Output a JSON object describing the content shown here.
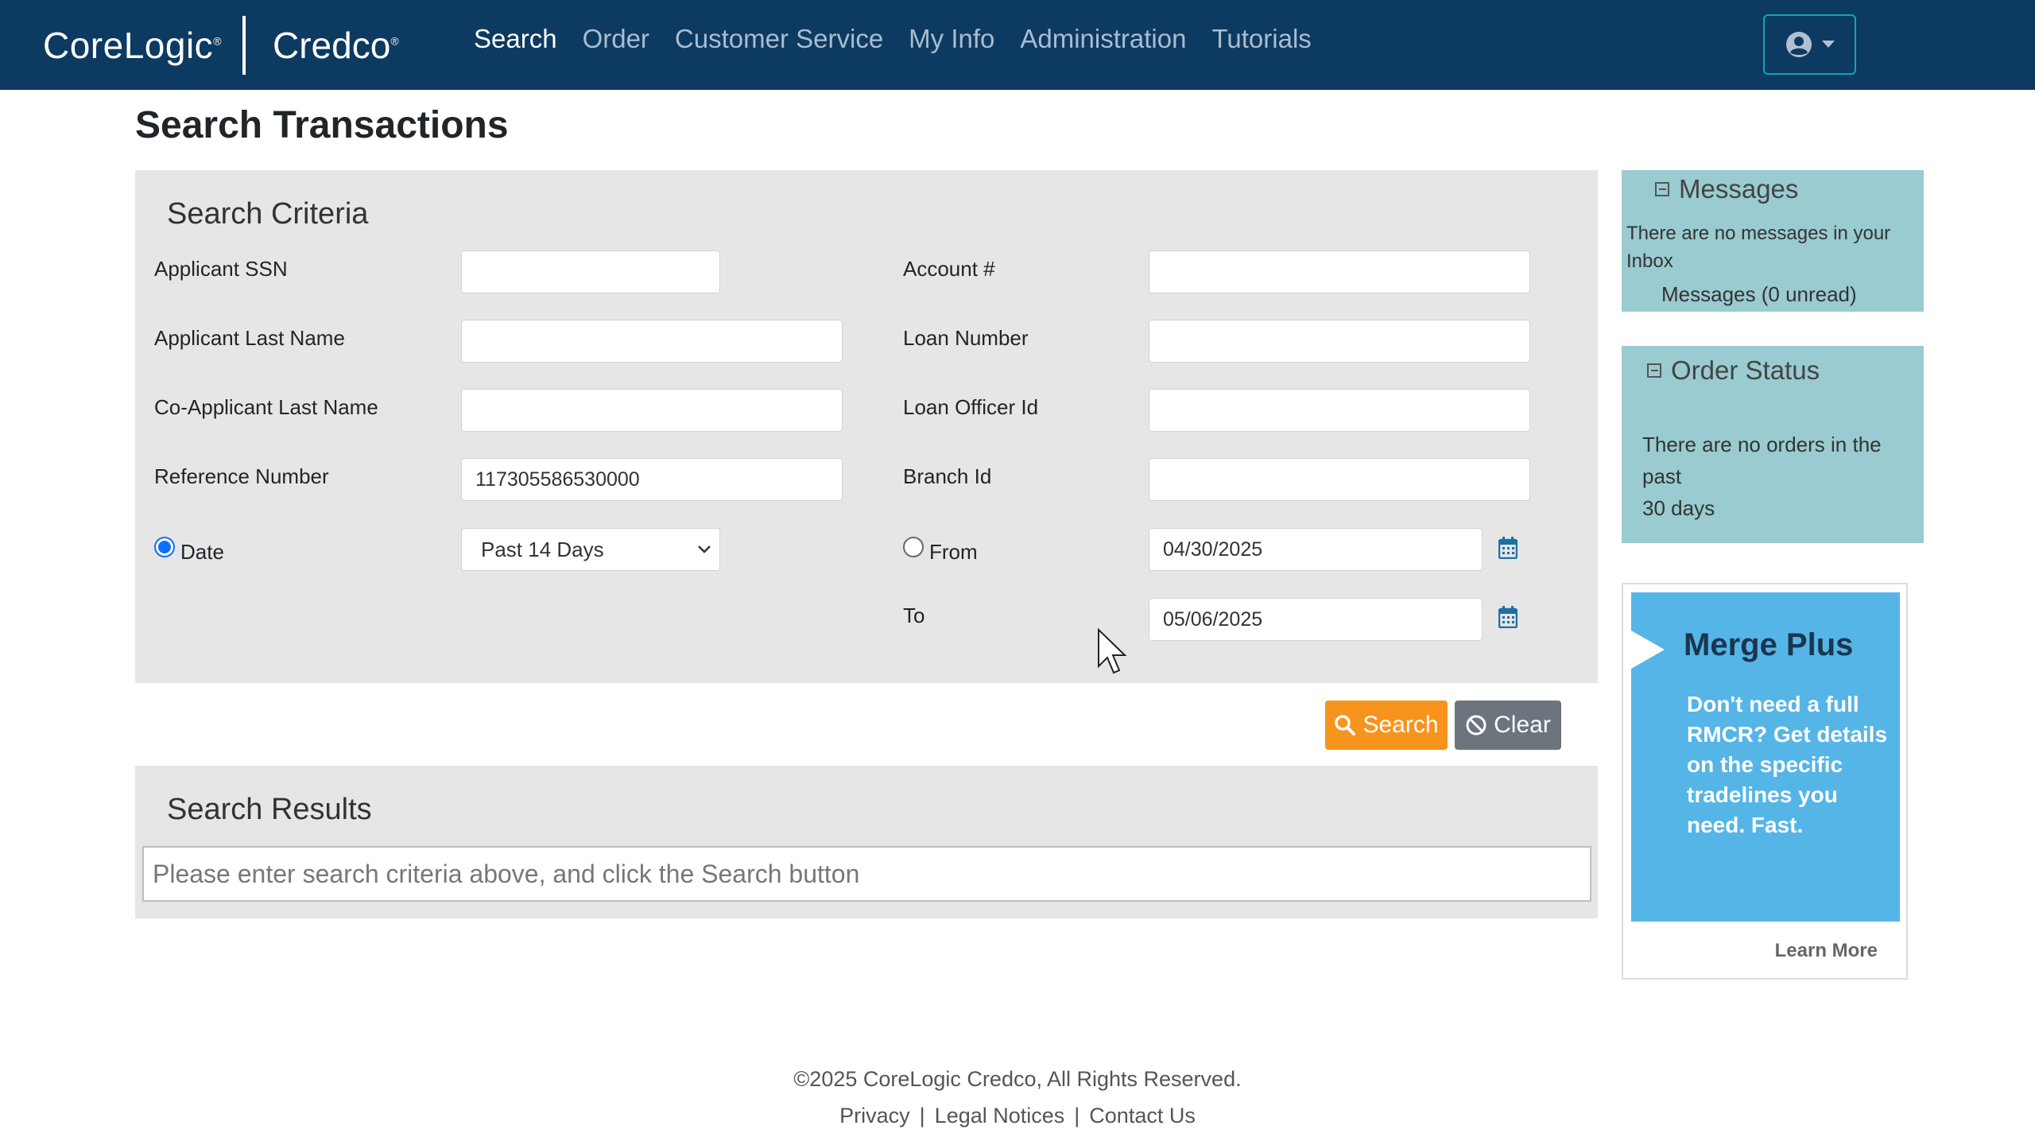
{
  "brand": {
    "primary": "CoreLogic",
    "secondary": "Credco"
  },
  "nav": {
    "items": [
      {
        "label": "Search",
        "active": true
      },
      {
        "label": "Order"
      },
      {
        "label": "Customer Service"
      },
      {
        "label": "My Info"
      },
      {
        "label": "Administration"
      },
      {
        "label": "Tutorials"
      }
    ],
    "user_menu_icon": "user-circle-icon"
  },
  "page": {
    "title": "Search Transactions"
  },
  "criteria": {
    "heading": "Search Criteria",
    "applicant_ssn": {
      "label": "Applicant SSN",
      "value": ""
    },
    "applicant_last_name": {
      "label": "Applicant Last Name",
      "value": ""
    },
    "co_applicant_last_name": {
      "label": "Co-Applicant Last Name",
      "value": ""
    },
    "reference_number": {
      "label": "Reference Number",
      "value": "117305586530000"
    },
    "date_radio": {
      "label": "Date",
      "checked": true
    },
    "date_range_select": {
      "selected": "Past 14 Days"
    },
    "account_number": {
      "label": "Account #",
      "value": ""
    },
    "loan_number": {
      "label": "Loan Number",
      "value": ""
    },
    "loan_officer_id": {
      "label": "Loan Officer Id",
      "value": ""
    },
    "branch_id": {
      "label": "Branch Id",
      "value": ""
    },
    "from_radio": {
      "label": "From",
      "checked": false
    },
    "from_date": "04/30/2025",
    "to_label": "To",
    "to_date": "05/06/2025"
  },
  "actions": {
    "search_label": "Search",
    "clear_label": "Clear"
  },
  "results": {
    "heading": "Search Results",
    "placeholder_text": "Please enter search criteria above, and click the Search button"
  },
  "sidebar": {
    "messages": {
      "heading": "Messages",
      "empty_text": "There are no messages in your Inbox",
      "summary": "Messages (0 unread)"
    },
    "order_status": {
      "heading": "Order Status",
      "line1": "There are no orders in the past",
      "line2": "30 days"
    },
    "ad": {
      "title": "Merge Plus",
      "body": "Don't need a full RMCR? Get details on the specific tradelines you need. Fast.",
      "link": "Learn More"
    }
  },
  "footer": {
    "copyright": "©2025 CoreLogic Credco, All Rights Reserved.",
    "links": [
      "Privacy",
      "Legal Notices",
      "Contact Us"
    ],
    "separator": "|"
  },
  "colors": {
    "navbar": "#0d3a61",
    "search_button": "#f7941d",
    "clear_button": "#6c757d",
    "sidebar_box": "#99cbd0",
    "ad_background": "#55b5e6",
    "panel": "#e6e6e6"
  }
}
